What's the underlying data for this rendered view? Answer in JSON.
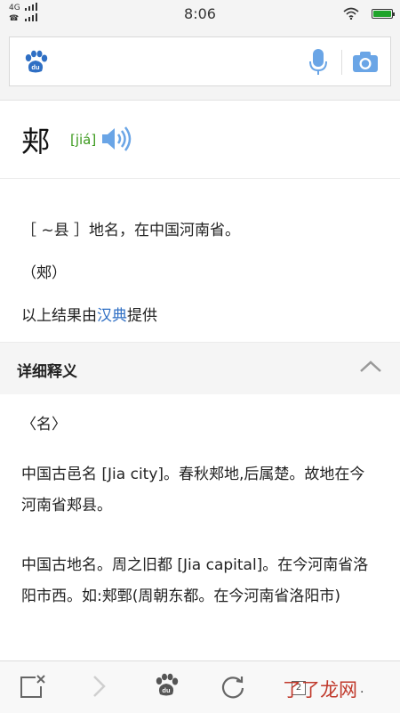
{
  "status": {
    "network_top": "4G",
    "network_bottom": "☎",
    "time": "8:06"
  },
  "search": {
    "value": "",
    "placeholder": ""
  },
  "entry": {
    "word": "郏",
    "pinyin": "[jiá]",
    "definition": "［ ~县 ］地名，在中国河南省。",
    "traditional": "（郟）",
    "source_prefix": "以上结果由",
    "source_link": "汉典",
    "source_suffix": "提供"
  },
  "details": {
    "title": "详细释义",
    "pos": "〈名〉",
    "para1": "中国古邑名 [Jia city]。春秋郏地,后属楚。故地在今河南省郏县。",
    "para2": "中国古地名。周之旧都 [Jia capital]。在今河南省洛阳市西。如:郏鄄(周朝东都。在今河南省洛阳市)"
  },
  "bottombar": {
    "tab_count": "2",
    "watermark": "了了龙网"
  },
  "colors": {
    "accent": "#2f6fc4",
    "pinyin": "#3c9a1e",
    "icon_blue": "#6aa5e6"
  }
}
